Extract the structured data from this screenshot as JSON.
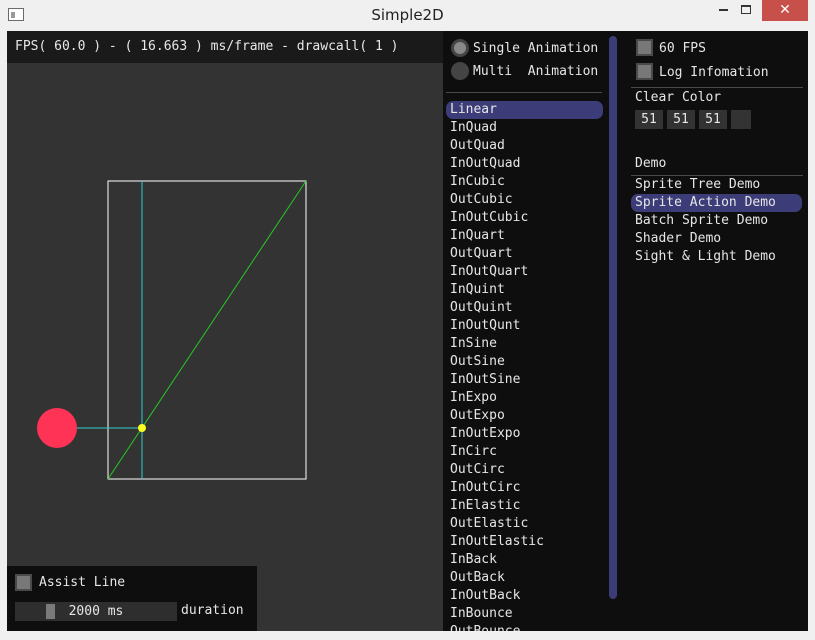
{
  "window": {
    "title": "Simple2D",
    "close_glyph": "✕"
  },
  "scene": {
    "fps_text": "FPS( 60.0 ) - ( 16.663 ) ms/frame - drawcall( 1 )",
    "colors": {
      "background": "#333333",
      "curve": "#22cc22",
      "guide": "#33cccc",
      "ball": "#ff3355",
      "marker": "#ffff22",
      "frame": "#ffffff"
    }
  },
  "assist": {
    "checkbox_label": "Assist Line",
    "duration_value": "2000 ms",
    "duration_label": "duration"
  },
  "animation_mode": {
    "options": [
      "Single Animation",
      "Multi  Animation"
    ],
    "selected": "Single Animation"
  },
  "easings": {
    "selected": "Linear",
    "items": [
      "Linear",
      "InQuad",
      "OutQuad",
      "InOutQuad",
      "InCubic",
      "OutCubic",
      "InOutCubic",
      "InQuart",
      "OutQuart",
      "InOutQuart",
      "InQuint",
      "OutQuint",
      "InOutQunt",
      "InSine",
      "OutSine",
      "InOutSine",
      "InExpo",
      "OutExpo",
      "InOutExpo",
      "InCirc",
      "OutCirc",
      "InOutCirc",
      "InElastic",
      "OutElastic",
      "InOutElastic",
      "InBack",
      "OutBack",
      "InOutBack",
      "InBounce",
      "OutBounce"
    ]
  },
  "settings": {
    "fps_label": "60 FPS",
    "log_label": "Log Infomation",
    "clear_color_label": "Clear Color",
    "clear_color": [
      "51",
      "51",
      "51"
    ],
    "demo_header": "Demo",
    "demos": [
      "Sprite Tree Demo",
      "Sprite Action Demo",
      "Batch Sprite Demo",
      "Shader Demo",
      "Sight & Light Demo"
    ],
    "selected_demo": "Sprite Action Demo"
  }
}
